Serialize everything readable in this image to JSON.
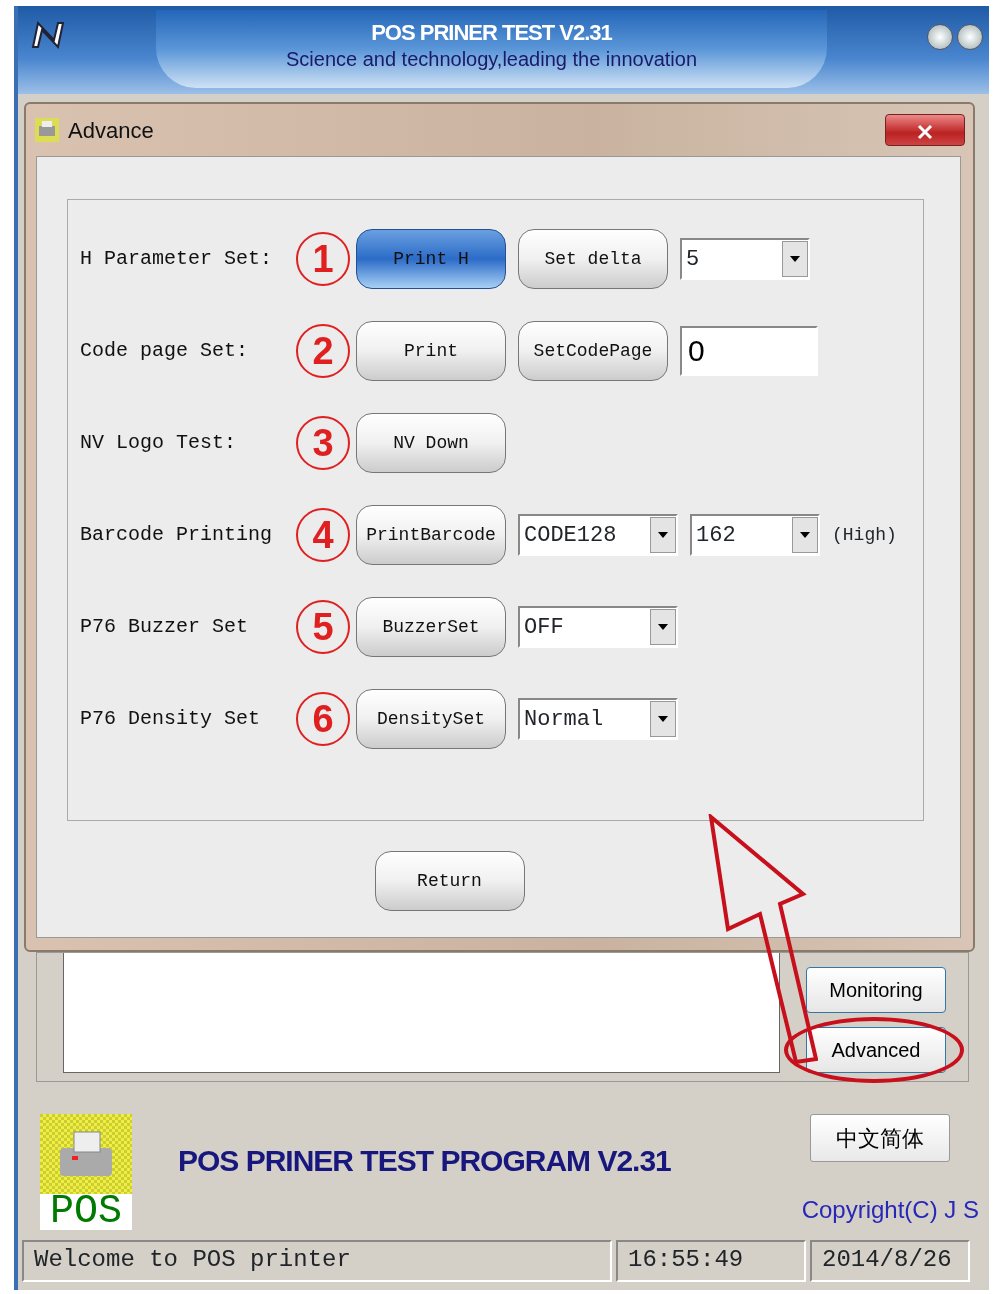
{
  "window": {
    "title": "POS PRINER TEST V2.31",
    "subtitle": "Science and technology,leading the innovation"
  },
  "dialog": {
    "title": "Advance",
    "rows": [
      {
        "label": "H Parameter Set:",
        "number": "1",
        "buttons": [
          {
            "label": "Print H",
            "highlighted": true
          },
          {
            "label": "Set delta",
            "highlighted": false
          }
        ],
        "fields": [
          {
            "kind": "select",
            "value": "5"
          }
        ]
      },
      {
        "label": "Code page Set:",
        "number": "2",
        "buttons": [
          {
            "label": "Print",
            "highlighted": false
          },
          {
            "label": "SetCodePage",
            "highlighted": false
          }
        ],
        "fields": [
          {
            "kind": "input",
            "value": "0"
          }
        ]
      },
      {
        "label": "NV Logo Test:",
        "number": "3",
        "buttons": [
          {
            "label": "NV Down",
            "highlighted": false
          }
        ],
        "fields": []
      },
      {
        "label": "Barcode Printing",
        "number": "4",
        "buttons": [
          {
            "label": "PrintBarcode",
            "highlighted": false
          }
        ],
        "fields": [
          {
            "kind": "select",
            "value": "CODE128"
          },
          {
            "kind": "select",
            "value": "162"
          }
        ],
        "suffix": "(High)"
      },
      {
        "label": "P76 Buzzer Set",
        "number": "5",
        "buttons": [
          {
            "label": "BuzzerSet",
            "highlighted": false
          }
        ],
        "fields": [
          {
            "kind": "select",
            "value": "OFF"
          }
        ]
      },
      {
        "label": "P76 Density Set",
        "number": "6",
        "buttons": [
          {
            "label": "DensitySet",
            "highlighted": false
          }
        ],
        "fields": [
          {
            "kind": "select",
            "value": "Normal"
          }
        ]
      }
    ],
    "return_button": "Return"
  },
  "main": {
    "side_buttons": [
      {
        "label": "Monitoring",
        "circled": false
      },
      {
        "label": "Advanced",
        "circled": true
      }
    ],
    "logo_text": "POS",
    "program_title": "POS PRINER TEST PROGRAM V2.31",
    "language_button": "中文简体",
    "copyright": "Copyright(C) J S"
  },
  "status_bar": [
    "Welcome to POS printer",
    "16:55:49",
    "2014/8/26"
  ]
}
